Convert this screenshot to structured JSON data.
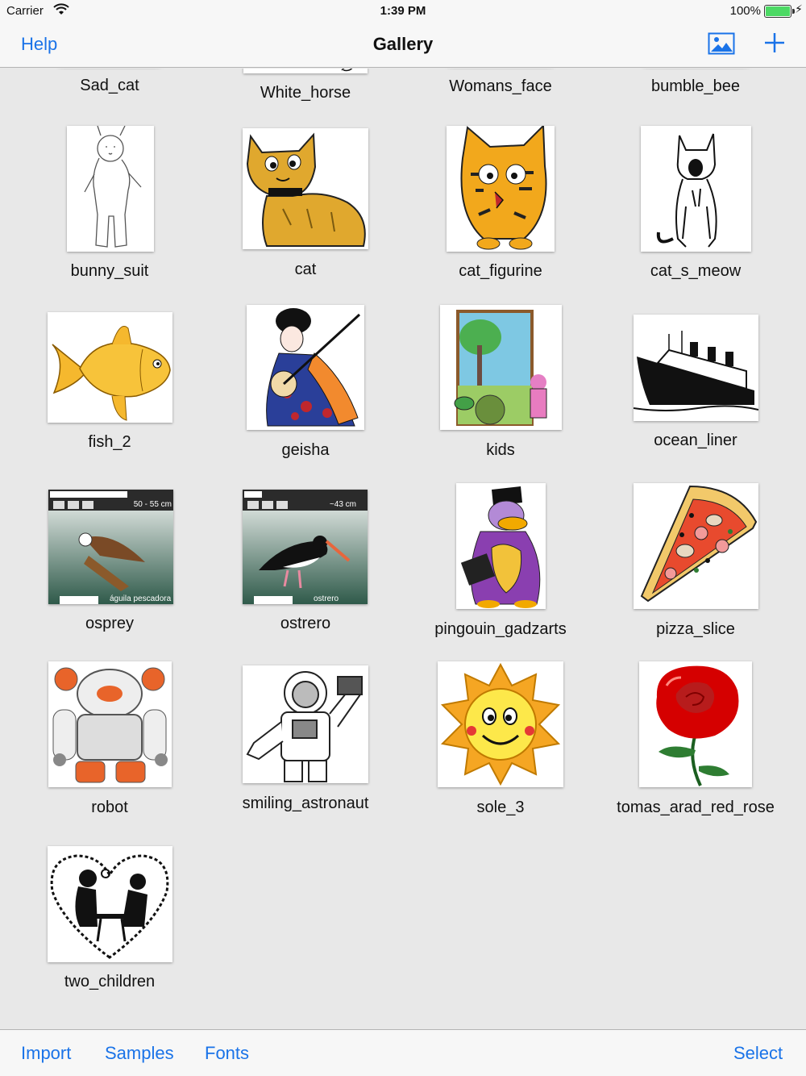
{
  "status_bar": {
    "carrier": "Carrier",
    "time": "1:39 PM",
    "battery": "100%"
  },
  "nav": {
    "help": "Help",
    "title": "Gallery"
  },
  "top_row": [
    "Sad_cat",
    "White_horse",
    "Womans_face",
    "bumble_bee"
  ],
  "items": [
    "bunny_suit",
    "cat",
    "cat_figurine",
    "cat_s_meow",
    "fish_2",
    "geisha",
    "kids",
    "ocean_liner",
    "osprey",
    "ostrero",
    "pingouin_gadzarts",
    "pizza_slice",
    "robot",
    "smiling_astronaut",
    "sole_3",
    "tomas_arad_red_rose",
    "two_children"
  ],
  "overlays": {
    "osprey_size": "50 - 55 cm",
    "osprey_caption": "águila pescadora",
    "ostrero_size": "~43 cm",
    "ostrero_caption": "ostrero"
  },
  "toolbar": {
    "import": "Import",
    "samples": "Samples",
    "fonts": "Fonts",
    "select": "Select"
  },
  "colors": {
    "accent": "#1a73e8",
    "background": "#e8e8e8",
    "bar": "#f7f7f7"
  }
}
